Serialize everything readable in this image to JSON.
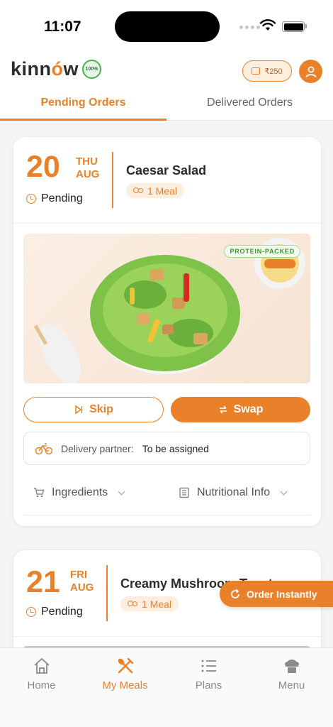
{
  "status_bar": {
    "time": "11:07"
  },
  "header": {
    "logo_text_a": "kinn",
    "logo_text_b": "ó",
    "logo_text_c": "w",
    "veg_badge": "100%",
    "wallet_amount": "₹250",
    "tabs": [
      {
        "label": "Pending Orders",
        "active": true
      },
      {
        "label": "Delivered Orders",
        "active": false
      }
    ]
  },
  "orders": [
    {
      "date": "20",
      "day": "THU",
      "month": "AUG",
      "status": "Pending",
      "meal_name": "Caesar Salad",
      "meal_count": "1 Meal",
      "image_tag": "PROTEIN-PACKED",
      "skip_label": "Skip",
      "swap_label": "Swap",
      "delivery_label": "Delivery partner:",
      "delivery_value": "To be assigned",
      "ingredients_label": "Ingredients",
      "nutrition_label": "Nutritional Info"
    },
    {
      "date": "21",
      "day": "FRI",
      "month": "AUG",
      "status": "Pending",
      "meal_name": "Creamy Mushroom Toast",
      "meal_count": "1 Meal"
    }
  ],
  "order_instantly_label": "Order Instantly",
  "bottom_nav": [
    {
      "label": "Home",
      "icon": "home-icon",
      "active": false
    },
    {
      "label": "My Meals",
      "icon": "fork-knife-icon",
      "active": true
    },
    {
      "label": "Plans",
      "icon": "list-icon",
      "active": false
    },
    {
      "label": "Menu",
      "icon": "chef-hat-icon",
      "active": false
    }
  ],
  "colors": {
    "accent": "#e8812a",
    "accent_light": "#fdeede",
    "tag_green": "#3e8e2b"
  }
}
